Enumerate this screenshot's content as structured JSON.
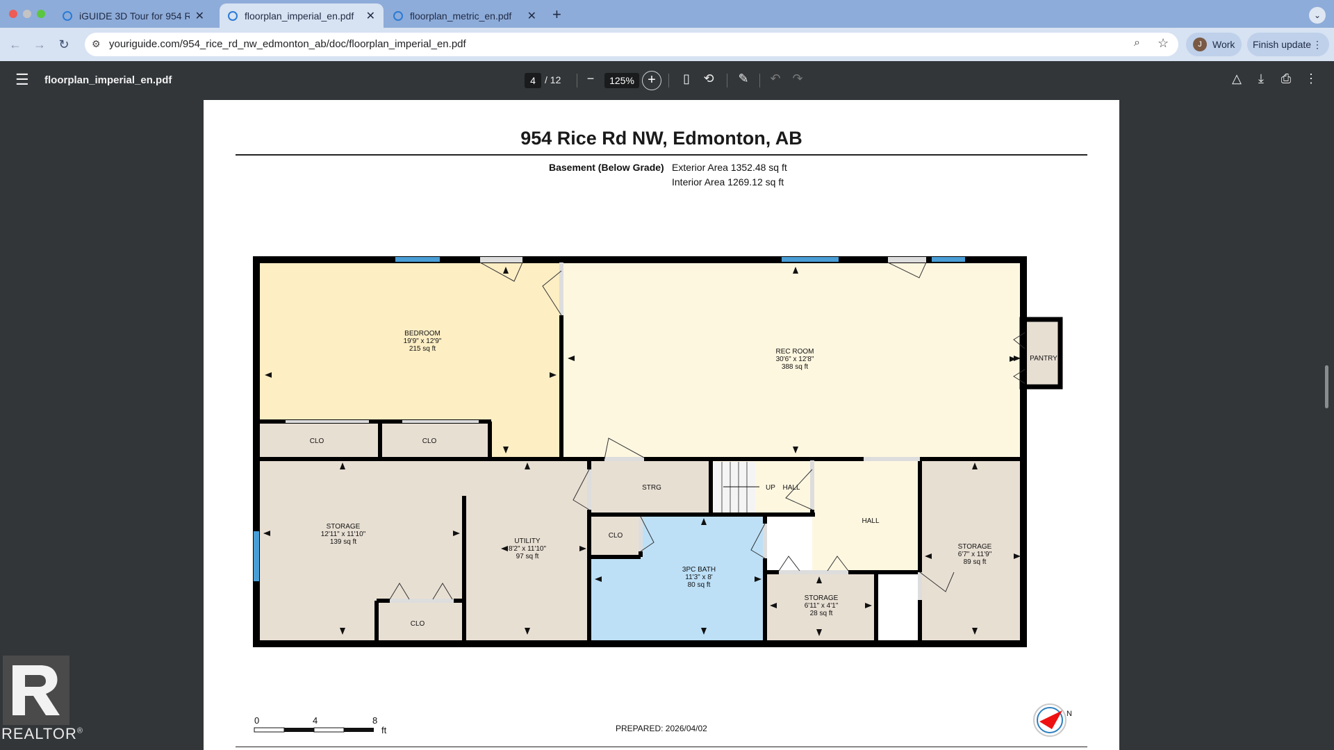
{
  "browser": {
    "tabs": [
      {
        "label": "iGUIDE 3D Tour for 954 Rice R",
        "active": false
      },
      {
        "label": "floorplan_imperial_en.pdf",
        "active": true
      },
      {
        "label": "floorplan_metric_en.pdf",
        "active": false
      }
    ],
    "url": "youriguide.com/954_rice_rd_nw_edmonton_ab/doc/floorplan_imperial_en.pdf",
    "profile_label": "Work",
    "profile_initial": "J",
    "update_label": "Finish update"
  },
  "pdf_toolbar": {
    "doc_name": "floorplan_imperial_en.pdf",
    "current_page": "4",
    "total_pages": "/ 12",
    "zoom": "125%"
  },
  "document": {
    "title": "954 Rice Rd NW, Edmonton, AB",
    "floor_label": "Basement (Below Grade)",
    "exterior_area": "Exterior Area 1352.48 sq ft",
    "interior_area": "Interior Area 1269.12 sq ft",
    "prepared": "PREPARED: 2026/04/02",
    "scale_labels": [
      "0",
      "4",
      "8",
      "ft"
    ],
    "compass_label": "N",
    "rooms": [
      {
        "name": "BEDROOM",
        "dims": "19'9\" x 12'9\"",
        "area": "215 sq ft"
      },
      {
        "name": "REC ROOM",
        "dims": "30'6\" x 12'8\"",
        "area": "388 sq ft"
      },
      {
        "name": "PANTRY"
      },
      {
        "name": "CLO"
      },
      {
        "name": "CLO"
      },
      {
        "name": "STRG"
      },
      {
        "name": "UP"
      },
      {
        "name": "HALL"
      },
      {
        "name": "HALL"
      },
      {
        "name": "STORAGE",
        "dims": "12'11\" x 11'10\"",
        "area": "139 sq ft"
      },
      {
        "name": "UTILITY",
        "dims": "8'2\" x 11'10\"",
        "area": "97 sq ft"
      },
      {
        "name": "CLO"
      },
      {
        "name": "3PC BATH",
        "dims": "11'3\" x 8'",
        "area": "80 sq ft"
      },
      {
        "name": "STORAGE",
        "dims": "6'7\" x 11'9\"",
        "area": "89 sq ft"
      },
      {
        "name": "STORAGE",
        "dims": "6'11\" x 4'1\"",
        "area": "28 sq ft"
      },
      {
        "name": "CLO"
      }
    ]
  },
  "watermark": {
    "text": "REALTOR",
    "mark": "®"
  },
  "colors": {
    "bedroom": "#fdeec4",
    "rec_room": "#fef7e0",
    "storage": "#e8dfd3",
    "bath": "#bde0f7",
    "window": "#4a9ed6",
    "tab_strip": "#8eacd9"
  }
}
